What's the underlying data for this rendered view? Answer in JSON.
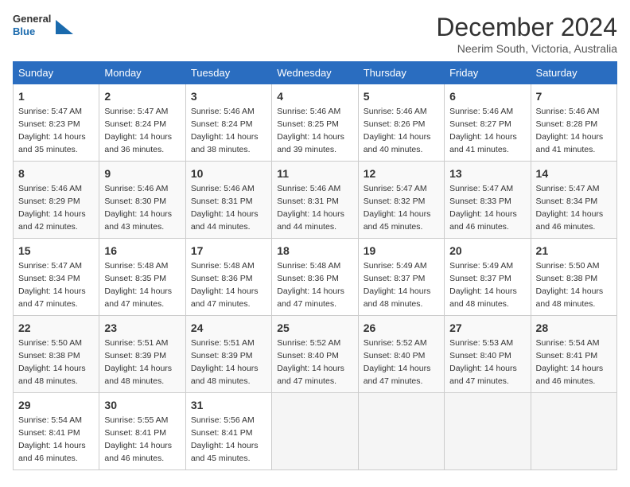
{
  "header": {
    "logo_general": "General",
    "logo_blue": "Blue",
    "title": "December 2024",
    "location": "Neerim South, Victoria, Australia"
  },
  "weekdays": [
    "Sunday",
    "Monday",
    "Tuesday",
    "Wednesday",
    "Thursday",
    "Friday",
    "Saturday"
  ],
  "weeks": [
    [
      {
        "day": "1",
        "sunrise": "5:47 AM",
        "sunset": "8:23 PM",
        "daylight": "14 hours and 35 minutes."
      },
      {
        "day": "2",
        "sunrise": "5:47 AM",
        "sunset": "8:24 PM",
        "daylight": "14 hours and 36 minutes."
      },
      {
        "day": "3",
        "sunrise": "5:46 AM",
        "sunset": "8:24 PM",
        "daylight": "14 hours and 38 minutes."
      },
      {
        "day": "4",
        "sunrise": "5:46 AM",
        "sunset": "8:25 PM",
        "daylight": "14 hours and 39 minutes."
      },
      {
        "day": "5",
        "sunrise": "5:46 AM",
        "sunset": "8:26 PM",
        "daylight": "14 hours and 40 minutes."
      },
      {
        "day": "6",
        "sunrise": "5:46 AM",
        "sunset": "8:27 PM",
        "daylight": "14 hours and 41 minutes."
      },
      {
        "day": "7",
        "sunrise": "5:46 AM",
        "sunset": "8:28 PM",
        "daylight": "14 hours and 41 minutes."
      }
    ],
    [
      {
        "day": "8",
        "sunrise": "5:46 AM",
        "sunset": "8:29 PM",
        "daylight": "14 hours and 42 minutes."
      },
      {
        "day": "9",
        "sunrise": "5:46 AM",
        "sunset": "8:30 PM",
        "daylight": "14 hours and 43 minutes."
      },
      {
        "day": "10",
        "sunrise": "5:46 AM",
        "sunset": "8:31 PM",
        "daylight": "14 hours and 44 minutes."
      },
      {
        "day": "11",
        "sunrise": "5:46 AM",
        "sunset": "8:31 PM",
        "daylight": "14 hours and 44 minutes."
      },
      {
        "day": "12",
        "sunrise": "5:47 AM",
        "sunset": "8:32 PM",
        "daylight": "14 hours and 45 minutes."
      },
      {
        "day": "13",
        "sunrise": "5:47 AM",
        "sunset": "8:33 PM",
        "daylight": "14 hours and 46 minutes."
      },
      {
        "day": "14",
        "sunrise": "5:47 AM",
        "sunset": "8:34 PM",
        "daylight": "14 hours and 46 minutes."
      }
    ],
    [
      {
        "day": "15",
        "sunrise": "5:47 AM",
        "sunset": "8:34 PM",
        "daylight": "14 hours and 47 minutes."
      },
      {
        "day": "16",
        "sunrise": "5:48 AM",
        "sunset": "8:35 PM",
        "daylight": "14 hours and 47 minutes."
      },
      {
        "day": "17",
        "sunrise": "5:48 AM",
        "sunset": "8:36 PM",
        "daylight": "14 hours and 47 minutes."
      },
      {
        "day": "18",
        "sunrise": "5:48 AM",
        "sunset": "8:36 PM",
        "daylight": "14 hours and 47 minutes."
      },
      {
        "day": "19",
        "sunrise": "5:49 AM",
        "sunset": "8:37 PM",
        "daylight": "14 hours and 48 minutes."
      },
      {
        "day": "20",
        "sunrise": "5:49 AM",
        "sunset": "8:37 PM",
        "daylight": "14 hours and 48 minutes."
      },
      {
        "day": "21",
        "sunrise": "5:50 AM",
        "sunset": "8:38 PM",
        "daylight": "14 hours and 48 minutes."
      }
    ],
    [
      {
        "day": "22",
        "sunrise": "5:50 AM",
        "sunset": "8:38 PM",
        "daylight": "14 hours and 48 minutes."
      },
      {
        "day": "23",
        "sunrise": "5:51 AM",
        "sunset": "8:39 PM",
        "daylight": "14 hours and 48 minutes."
      },
      {
        "day": "24",
        "sunrise": "5:51 AM",
        "sunset": "8:39 PM",
        "daylight": "14 hours and 48 minutes."
      },
      {
        "day": "25",
        "sunrise": "5:52 AM",
        "sunset": "8:40 PM",
        "daylight": "14 hours and 47 minutes."
      },
      {
        "day": "26",
        "sunrise": "5:52 AM",
        "sunset": "8:40 PM",
        "daylight": "14 hours and 47 minutes."
      },
      {
        "day": "27",
        "sunrise": "5:53 AM",
        "sunset": "8:40 PM",
        "daylight": "14 hours and 47 minutes."
      },
      {
        "day": "28",
        "sunrise": "5:54 AM",
        "sunset": "8:41 PM",
        "daylight": "14 hours and 46 minutes."
      }
    ],
    [
      {
        "day": "29",
        "sunrise": "5:54 AM",
        "sunset": "8:41 PM",
        "daylight": "14 hours and 46 minutes."
      },
      {
        "day": "30",
        "sunrise": "5:55 AM",
        "sunset": "8:41 PM",
        "daylight": "14 hours and 46 minutes."
      },
      {
        "day": "31",
        "sunrise": "5:56 AM",
        "sunset": "8:41 PM",
        "daylight": "14 hours and 45 minutes."
      },
      null,
      null,
      null,
      null
    ]
  ]
}
